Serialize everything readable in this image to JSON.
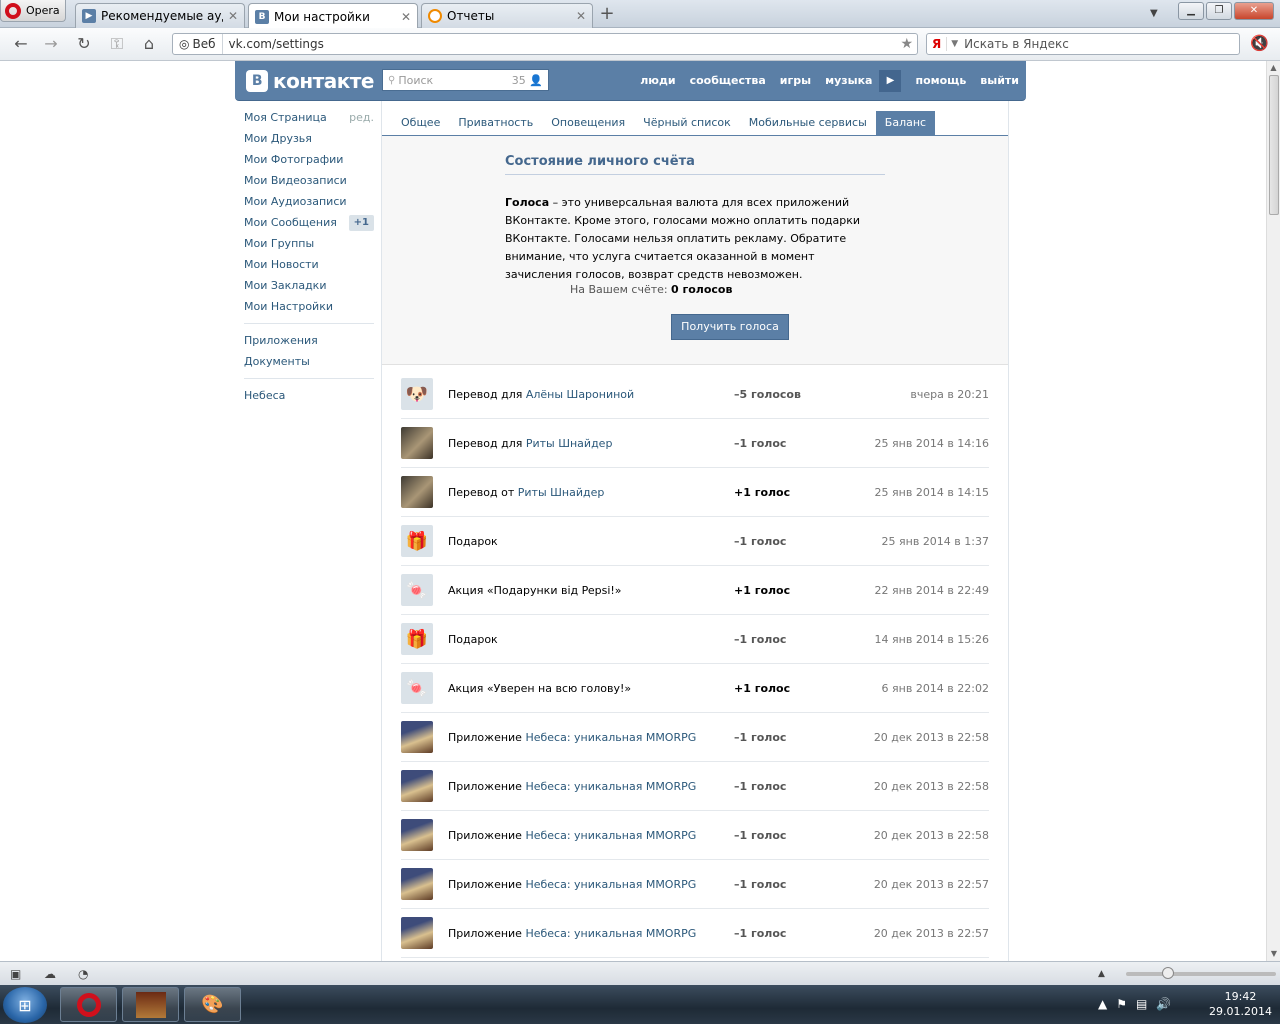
{
  "browser": {
    "menu_label": "Opera",
    "tabs": [
      {
        "label": "Рекомендуемые ауди...",
        "icon": "vk-play-icon"
      },
      {
        "label": "Мои настройки",
        "icon": "vk-icon",
        "active": true
      },
      {
        "label": "Отчеты",
        "icon": "search-icon"
      }
    ],
    "address_badge": "Веб",
    "url": "vk.com/settings",
    "search_placeholder": "Искать в Яндекс",
    "search_engine_label": "Я"
  },
  "vk": {
    "logo_text": "контакте",
    "logo_letter": "В",
    "search_placeholder": "Поиск",
    "search_count": "35",
    "nav": [
      "люди",
      "сообщества",
      "игры",
      "музыка",
      "помощь",
      "выйти"
    ],
    "left_menu": [
      {
        "label": "Моя Страница",
        "extra": "ред."
      },
      {
        "label": "Мои Друзья"
      },
      {
        "label": "Мои Фотографии"
      },
      {
        "label": "Мои Видеозаписи"
      },
      {
        "label": "Мои Аудиозаписи"
      },
      {
        "label": "Мои Сообщения",
        "badge": "+1"
      },
      {
        "label": "Мои Группы"
      },
      {
        "label": "Мои Новости"
      },
      {
        "label": "Мои Закладки"
      },
      {
        "label": "Мои Настройки"
      }
    ],
    "left_menu_2": [
      "Приложения",
      "Документы"
    ],
    "left_menu_3": [
      "Небеса"
    ],
    "settings_tabs": [
      "Общее",
      "Приватность",
      "Оповещения",
      "Чёрный список",
      "Мобильные сервисы",
      "Баланс"
    ],
    "balance": {
      "title": "Состояние личного счёта",
      "intro_bold": "Голоса",
      "intro_text": " – это универсальная валюта для всех приложений ВКонтакте. Кроме этого, голосами можно оплатить подарки ВКонтакте. Голосами нельзя оплатить рекламу. Обратите внимание, что услуга считается оказанной в момент зачисления голосов, возврат средств невозможен.",
      "account_label": "На Вашем счёте:",
      "account_value": "0 голосов",
      "button_label": "Получить голоса"
    },
    "transactions": [
      {
        "icon": "dog-avatar",
        "prefix": "Перевод для ",
        "link": "Алёны Шарониной",
        "amount": "–5 голосов",
        "plus": false,
        "date": "вчера в 20:21"
      },
      {
        "icon": "girl-avatar",
        "prefix": "Перевод для ",
        "link": "Риты Шнайдер",
        "amount": "–1 голос",
        "plus": false,
        "date": "25 янв 2014 в 14:16"
      },
      {
        "icon": "girl-avatar",
        "prefix": "Перевод от ",
        "link": "Риты Шнайдер",
        "amount": "+1 голос",
        "plus": true,
        "date": "25 янв 2014 в 14:15"
      },
      {
        "icon": "gift-icon",
        "prefix": "Подарок",
        "link": "",
        "amount": "–1 голос",
        "plus": false,
        "date": "25 янв 2014 в 1:37"
      },
      {
        "icon": "candy-icon",
        "prefix": "Акция «Подарунки від Pepsi!»",
        "link": "",
        "amount": "+1 голос",
        "plus": true,
        "date": "22 янв 2014 в 22:49"
      },
      {
        "icon": "gift-icon",
        "prefix": "Подарок",
        "link": "",
        "amount": "–1 голос",
        "plus": false,
        "date": "14 янв 2014 в 15:26"
      },
      {
        "icon": "candy-icon",
        "prefix": "Акция «Уверен на всю голову!»",
        "link": "",
        "amount": "+1 голос",
        "plus": true,
        "date": "6 янв 2014 в 22:02"
      },
      {
        "icon": "app-avatar",
        "prefix": "Приложение ",
        "link": "Небеса: уникальная MMORPG",
        "amount": "–1 голос",
        "plus": false,
        "date": "20 дек 2013 в 22:58"
      },
      {
        "icon": "app-avatar",
        "prefix": "Приложение ",
        "link": "Небеса: уникальная MMORPG",
        "amount": "–1 голос",
        "plus": false,
        "date": "20 дек 2013 в 22:58"
      },
      {
        "icon": "app-avatar",
        "prefix": "Приложение ",
        "link": "Небеса: уникальная MMORPG",
        "amount": "–1 голос",
        "plus": false,
        "date": "20 дек 2013 в 22:58"
      },
      {
        "icon": "app-avatar",
        "prefix": "Приложение ",
        "link": "Небеса: уникальная MMORPG",
        "amount": "–1 голос",
        "plus": false,
        "date": "20 дек 2013 в 22:57"
      },
      {
        "icon": "app-avatar",
        "prefix": "Приложение ",
        "link": "Небеса: уникальная MMORPG",
        "amount": "–1 голос",
        "plus": false,
        "date": "20 дек 2013 в 22:57"
      }
    ]
  },
  "taskbar": {
    "time": "19:42",
    "date": "29.01.2014"
  },
  "colors": {
    "vk_blue": "#5b7fa6",
    "link": "#2b587a",
    "opera_red": "#d0101c"
  }
}
